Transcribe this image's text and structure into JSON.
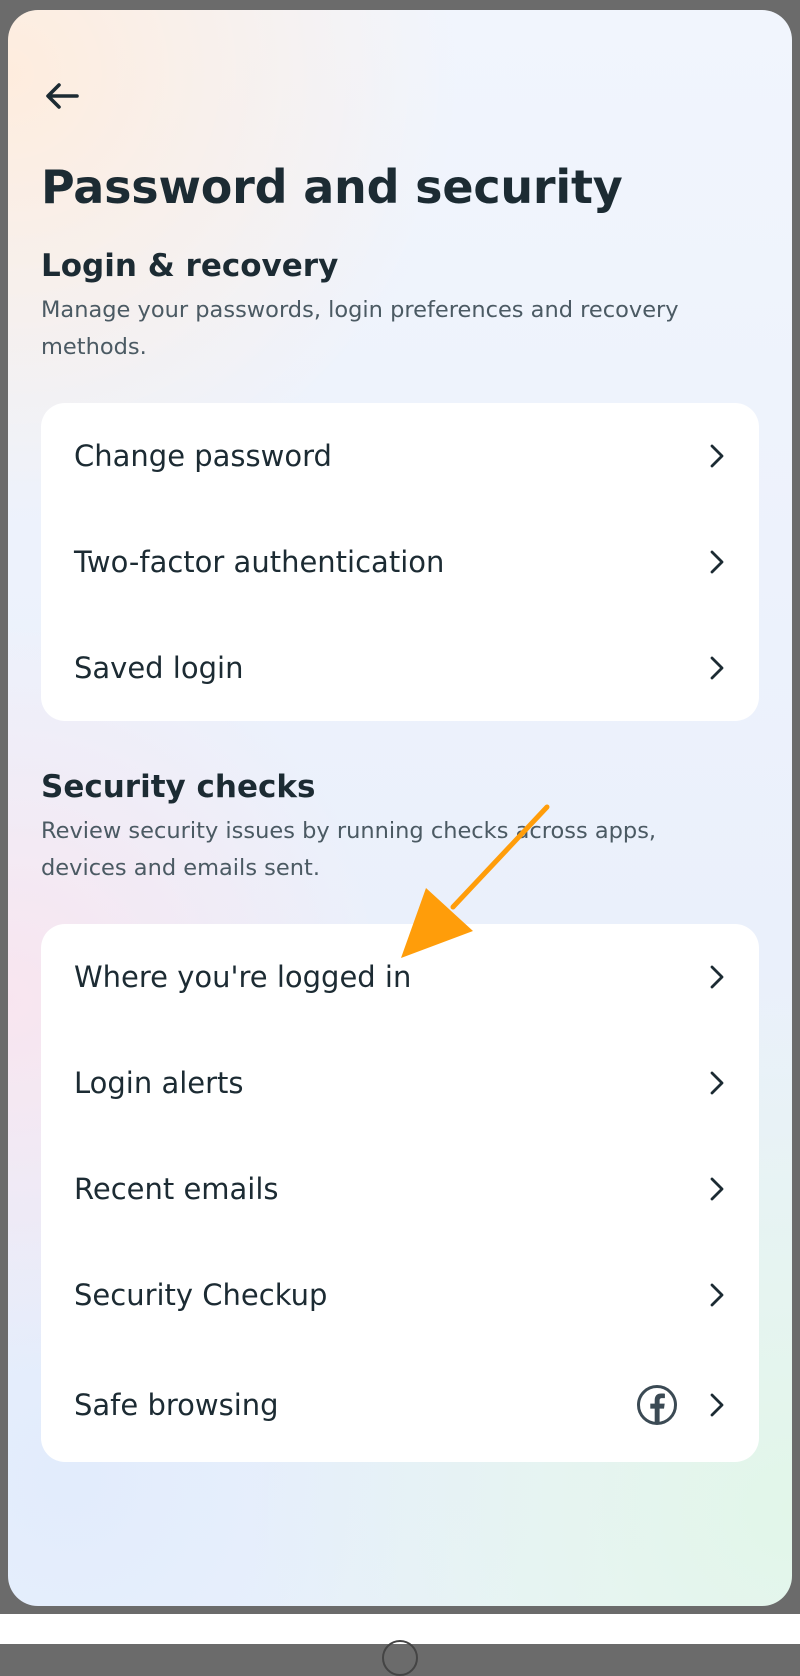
{
  "header": {
    "back_icon": "arrow-left-icon",
    "title": "Password and security"
  },
  "login_recovery": {
    "title": "Login & recovery",
    "description": "Manage your passwords, login preferences and recovery methods.",
    "items": [
      {
        "label": "Change password",
        "icon": "chevron-right-icon"
      },
      {
        "label": "Two-factor authentication",
        "icon": "chevron-right-icon"
      },
      {
        "label": "Saved login",
        "icon": "chevron-right-icon"
      }
    ]
  },
  "security_checks": {
    "title": "Security checks",
    "description": "Review security issues by running checks across apps, devices and emails sent.",
    "items": [
      {
        "label": "Where you're logged in",
        "icon": "chevron-right-icon"
      },
      {
        "label": "Login alerts",
        "icon": "chevron-right-icon"
      },
      {
        "label": "Recent emails",
        "icon": "chevron-right-icon"
      },
      {
        "label": "Security Checkup",
        "icon": "chevron-right-icon"
      },
      {
        "label": "Safe browsing",
        "icon": "chevron-right-icon",
        "badge_icon": "facebook-icon"
      }
    ]
  },
  "annotation": {
    "icon": "annotation-arrow-icon",
    "color": "#ff9d0a"
  },
  "colors": {
    "text_primary": "#1c2b33",
    "text_secondary": "#4b5a63",
    "card_bg": "#ffffff"
  }
}
